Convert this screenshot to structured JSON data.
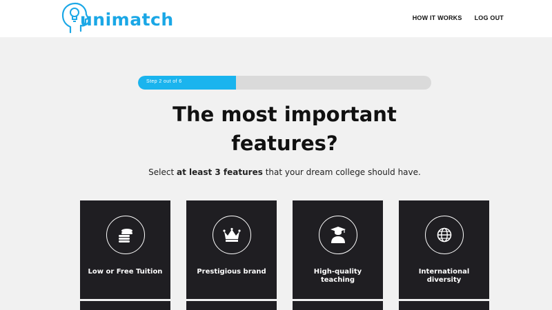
{
  "brand": {
    "name": "unimatch",
    "color": "#1aa7e6",
    "icon": "head-lightbulb-icon"
  },
  "nav": {
    "how_it_works": "HOW IT WORKS",
    "log_out": "LOG OUT"
  },
  "progress": {
    "label": "Step 2 out of 6",
    "current": 2,
    "total": 6,
    "fill_color": "#1ab4ee"
  },
  "heading": {
    "line1": "The most important",
    "line2": "features?"
  },
  "subtitle": {
    "before": "Select ",
    "bold": "at least 3 features",
    "after": " that your dream college should have."
  },
  "features": [
    {
      "label": "Low or Free Tuition",
      "icon": "coins-icon"
    },
    {
      "label": "Prestigious brand",
      "icon": "crown-icon"
    },
    {
      "label": "High-quality teaching",
      "icon": "graduate-icon"
    },
    {
      "label": "International diversity",
      "icon": "globe-icon"
    }
  ],
  "colors": {
    "card": "#1f1e22",
    "background": "#f1f1f1"
  }
}
